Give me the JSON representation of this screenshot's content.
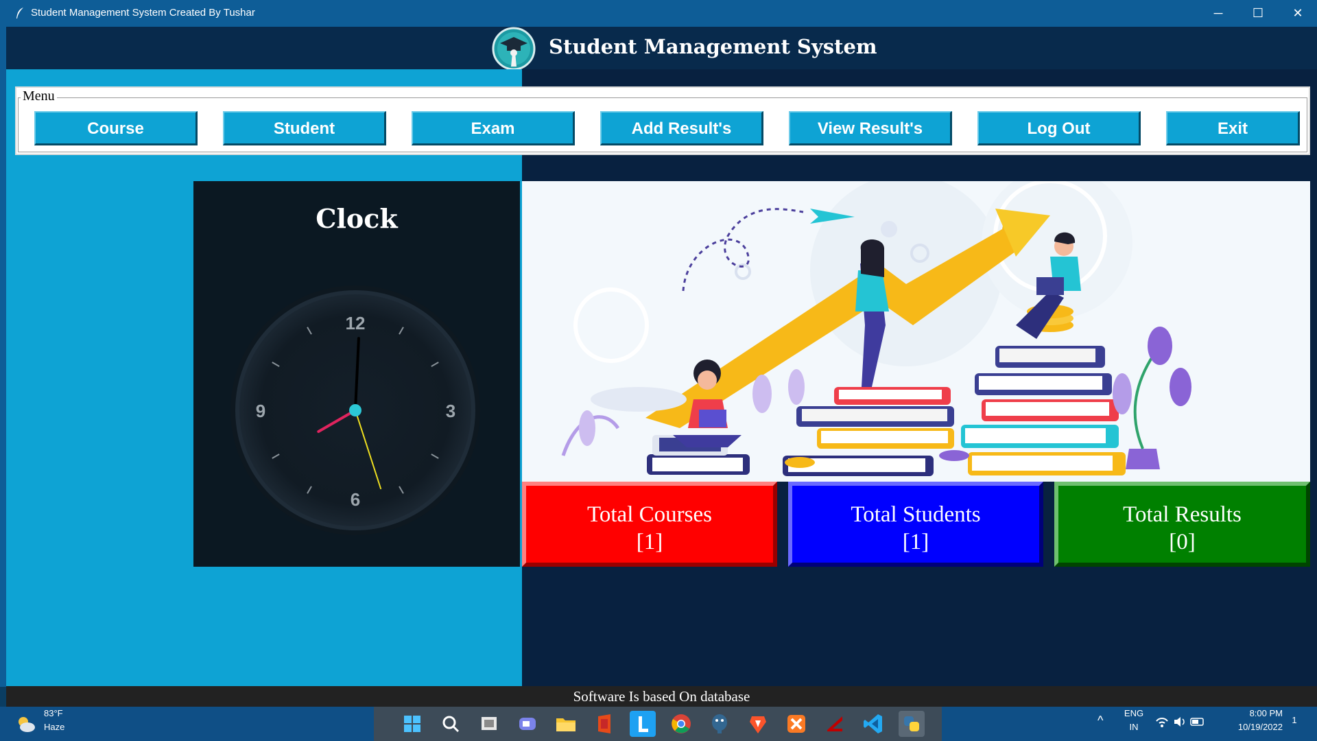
{
  "window": {
    "title": "Student Management System Created By Tushar",
    "minimize": "─",
    "maximize": "☐",
    "close": "✕"
  },
  "header": {
    "title": "Student Management System"
  },
  "menu": {
    "legend": "Menu",
    "buttons": [
      "Course",
      "Student",
      "Exam",
      "Add Result's",
      "View Result's",
      "Log Out",
      "Exit"
    ]
  },
  "clock": {
    "title": "Clock",
    "numerals": [
      "12",
      "3",
      "6",
      "9"
    ],
    "time": {
      "hour": 8,
      "minute": 0,
      "second": 27
    }
  },
  "stats": {
    "courses": {
      "label": "Total Courses",
      "value": "[1]"
    },
    "students": {
      "label": "Total Students",
      "value": "[1]"
    },
    "results": {
      "label": "Total Results",
      "value": "[0]"
    }
  },
  "footer": {
    "text": "Software Is based On database"
  },
  "taskbar": {
    "weather": {
      "temp": "83°F",
      "condition": "Haze"
    },
    "apps": [
      "windows-start",
      "search",
      "task-view",
      "teams-chat",
      "file-explorer",
      "office",
      "l-app",
      "chrome",
      "postgres",
      "brave",
      "xampp",
      "filezilla",
      "vscode",
      "python"
    ],
    "lang": "ENG",
    "region": "IN",
    "time": "8:00 PM",
    "date": "10/19/2022",
    "notifications": "1"
  },
  "colors": {
    "accent": "#0ea3d4",
    "dark": "#082140",
    "courses": "#ff0000",
    "students": "#0000ff",
    "results": "#008000"
  }
}
